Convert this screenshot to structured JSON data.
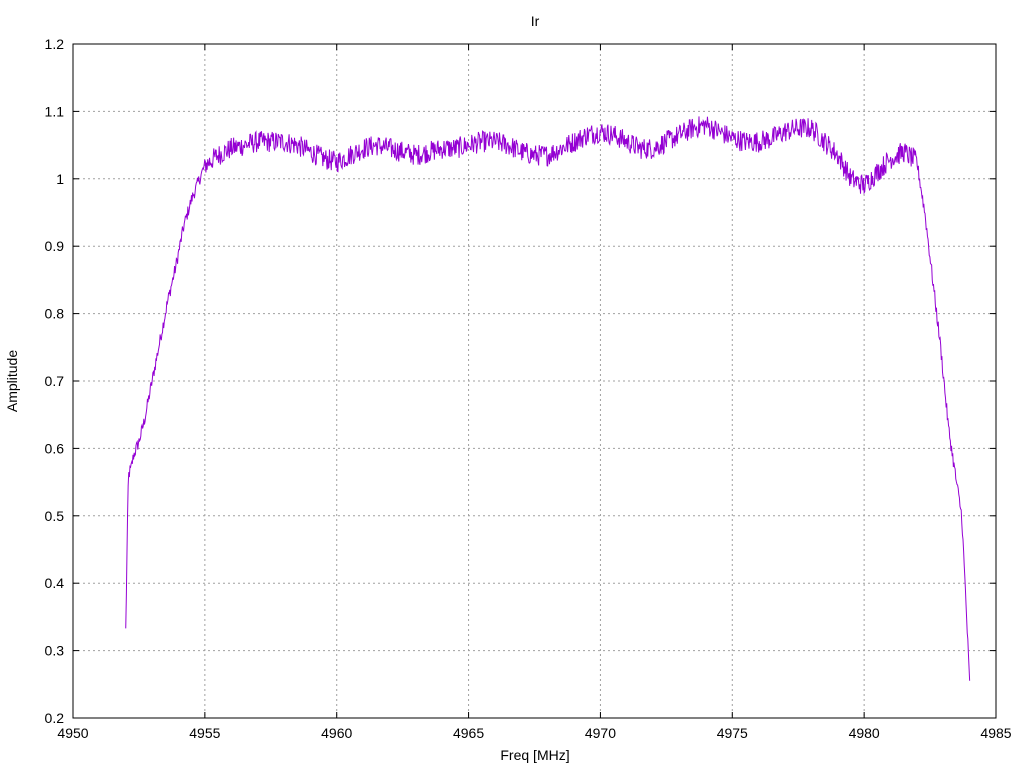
{
  "chart_data": {
    "type": "line",
    "title": "Ir",
    "xlabel": "Freq [MHz]",
    "ylabel": "Amplitude",
    "xlim": [
      4950,
      4985
    ],
    "ylim": [
      0.2,
      1.2
    ],
    "xticks": [
      4950,
      4955,
      4960,
      4965,
      4970,
      4975,
      4980,
      4985
    ],
    "xtick_labels": [
      "4950",
      "4955",
      "4960",
      "4965",
      "4970",
      "4975",
      "4980",
      "4985"
    ],
    "yticks": [
      0.2,
      0.3,
      0.4,
      0.5,
      0.6,
      0.7,
      0.8,
      0.9,
      1.0,
      1.1,
      1.2
    ],
    "ytick_labels": [
      "0.2",
      "0.3",
      "0.4",
      "0.5",
      "0.6",
      "0.7",
      "0.8",
      "0.9",
      "1",
      "1.1",
      "1.2"
    ],
    "grid": true,
    "color": "#9400d3",
    "series": [
      {
        "x": [
          4952.0,
          4952.05,
          4952.1,
          4952.2,
          4952.3,
          4952.5,
          4952.7,
          4953.0,
          4953.3,
          4953.6,
          4953.9,
          4954.2,
          4954.5,
          4954.8,
          4955.0,
          4955.5,
          4956.0,
          4956.5,
          4957.0,
          4957.5,
          4958.0,
          4958.5,
          4959.0,
          4959.5,
          4960.0,
          4960.5,
          4961.0,
          4961.5,
          4962.0,
          4962.5,
          4963.0,
          4963.5,
          4964.0,
          4964.5,
          4965.0,
          4965.5,
          4966.0,
          4966.5,
          4967.0,
          4967.5,
          4968.0,
          4968.5,
          4969.0,
          4969.5,
          4970.0,
          4970.5,
          4971.0,
          4971.5,
          4972.0,
          4972.5,
          4973.0,
          4973.5,
          4974.0,
          4974.5,
          4975.0,
          4975.5,
          4976.0,
          4976.5,
          4977.0,
          4977.5,
          4978.0,
          4978.5,
          4979.0,
          4979.5,
          4980.0,
          4980.5,
          4981.0,
          4981.5,
          4982.0,
          4982.3,
          4982.6,
          4982.9,
          4983.2,
          4983.5,
          4983.7,
          4983.85,
          4984.0
        ],
        "y": [
          0.33,
          0.45,
          0.56,
          0.57,
          0.59,
          0.61,
          0.64,
          0.7,
          0.76,
          0.82,
          0.87,
          0.93,
          0.97,
          1.0,
          1.02,
          1.035,
          1.045,
          1.05,
          1.055,
          1.055,
          1.055,
          1.05,
          1.04,
          1.03,
          1.025,
          1.035,
          1.045,
          1.05,
          1.045,
          1.04,
          1.035,
          1.04,
          1.045,
          1.045,
          1.05,
          1.055,
          1.055,
          1.05,
          1.04,
          1.035,
          1.035,
          1.045,
          1.055,
          1.065,
          1.07,
          1.065,
          1.055,
          1.045,
          1.045,
          1.055,
          1.065,
          1.075,
          1.08,
          1.07,
          1.06,
          1.055,
          1.055,
          1.06,
          1.07,
          1.075,
          1.075,
          1.055,
          1.035,
          1.0,
          0.99,
          1.01,
          1.03,
          1.04,
          1.025,
          0.95,
          0.85,
          0.75,
          0.63,
          0.55,
          0.5,
          0.38,
          0.25
        ]
      }
    ]
  }
}
